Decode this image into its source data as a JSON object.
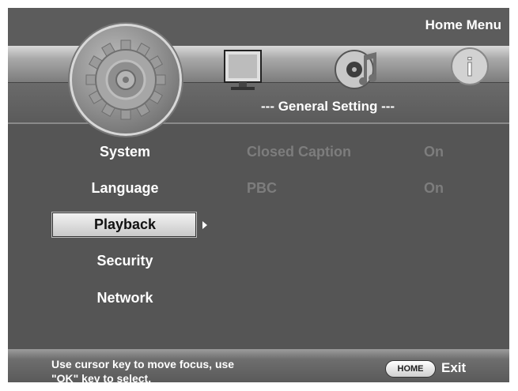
{
  "header": {
    "title": "Home Menu",
    "section_title": "--- General Setting ---",
    "tab_icons": [
      "gear-icon",
      "monitor-icon",
      "audio-disc-icon",
      "info-icon"
    ],
    "info_glyph": "i"
  },
  "menu": {
    "items": [
      {
        "label": "System"
      },
      {
        "label": "Language"
      },
      {
        "label": "Playback"
      },
      {
        "label": "Security"
      },
      {
        "label": "Network"
      }
    ],
    "selected": "Playback"
  },
  "settings": [
    {
      "label": "Closed Caption",
      "value": "On"
    },
    {
      "label": "PBC",
      "value": "On"
    }
  ],
  "footer": {
    "hint_line1": "Use cursor key to move focus, use",
    "hint_line2": "\"OK\" key to select.",
    "home_button": "HOME",
    "exit_label": "Exit"
  },
  "colors": {
    "background": "#555555",
    "text": "#ffffff",
    "disabled_text": "#7d7d7d",
    "highlight": "#e6e6e6"
  }
}
